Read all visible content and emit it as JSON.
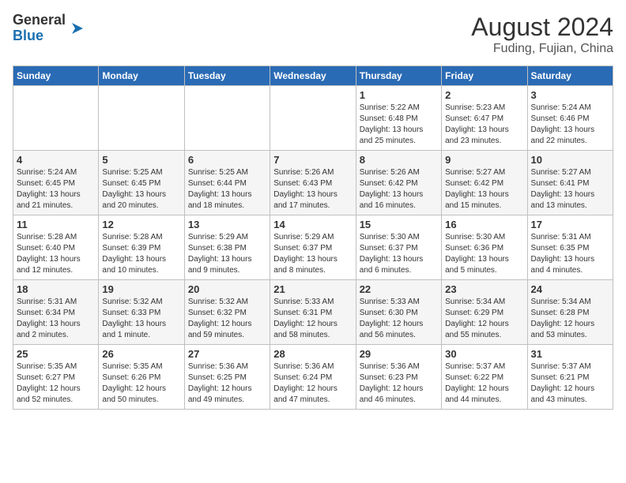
{
  "header": {
    "logo": {
      "general": "General",
      "blue": "Blue"
    },
    "title": "August 2024",
    "location": "Fuding, Fujian, China"
  },
  "calendar": {
    "days_of_week": [
      "Sunday",
      "Monday",
      "Tuesday",
      "Wednesday",
      "Thursday",
      "Friday",
      "Saturday"
    ],
    "weeks": [
      [
        {
          "day": "",
          "info": ""
        },
        {
          "day": "",
          "info": ""
        },
        {
          "day": "",
          "info": ""
        },
        {
          "day": "",
          "info": ""
        },
        {
          "day": "1",
          "info": "Sunrise: 5:22 AM\nSunset: 6:48 PM\nDaylight: 13 hours\nand 25 minutes."
        },
        {
          "day": "2",
          "info": "Sunrise: 5:23 AM\nSunset: 6:47 PM\nDaylight: 13 hours\nand 23 minutes."
        },
        {
          "day": "3",
          "info": "Sunrise: 5:24 AM\nSunset: 6:46 PM\nDaylight: 13 hours\nand 22 minutes."
        }
      ],
      [
        {
          "day": "4",
          "info": "Sunrise: 5:24 AM\nSunset: 6:45 PM\nDaylight: 13 hours\nand 21 minutes."
        },
        {
          "day": "5",
          "info": "Sunrise: 5:25 AM\nSunset: 6:45 PM\nDaylight: 13 hours\nand 20 minutes."
        },
        {
          "day": "6",
          "info": "Sunrise: 5:25 AM\nSunset: 6:44 PM\nDaylight: 13 hours\nand 18 minutes."
        },
        {
          "day": "7",
          "info": "Sunrise: 5:26 AM\nSunset: 6:43 PM\nDaylight: 13 hours\nand 17 minutes."
        },
        {
          "day": "8",
          "info": "Sunrise: 5:26 AM\nSunset: 6:42 PM\nDaylight: 13 hours\nand 16 minutes."
        },
        {
          "day": "9",
          "info": "Sunrise: 5:27 AM\nSunset: 6:42 PM\nDaylight: 13 hours\nand 15 minutes."
        },
        {
          "day": "10",
          "info": "Sunrise: 5:27 AM\nSunset: 6:41 PM\nDaylight: 13 hours\nand 13 minutes."
        }
      ],
      [
        {
          "day": "11",
          "info": "Sunrise: 5:28 AM\nSunset: 6:40 PM\nDaylight: 13 hours\nand 12 minutes."
        },
        {
          "day": "12",
          "info": "Sunrise: 5:28 AM\nSunset: 6:39 PM\nDaylight: 13 hours\nand 10 minutes."
        },
        {
          "day": "13",
          "info": "Sunrise: 5:29 AM\nSunset: 6:38 PM\nDaylight: 13 hours\nand 9 minutes."
        },
        {
          "day": "14",
          "info": "Sunrise: 5:29 AM\nSunset: 6:37 PM\nDaylight: 13 hours\nand 8 minutes."
        },
        {
          "day": "15",
          "info": "Sunrise: 5:30 AM\nSunset: 6:37 PM\nDaylight: 13 hours\nand 6 minutes."
        },
        {
          "day": "16",
          "info": "Sunrise: 5:30 AM\nSunset: 6:36 PM\nDaylight: 13 hours\nand 5 minutes."
        },
        {
          "day": "17",
          "info": "Sunrise: 5:31 AM\nSunset: 6:35 PM\nDaylight: 13 hours\nand 4 minutes."
        }
      ],
      [
        {
          "day": "18",
          "info": "Sunrise: 5:31 AM\nSunset: 6:34 PM\nDaylight: 13 hours\nand 2 minutes."
        },
        {
          "day": "19",
          "info": "Sunrise: 5:32 AM\nSunset: 6:33 PM\nDaylight: 13 hours\nand 1 minute."
        },
        {
          "day": "20",
          "info": "Sunrise: 5:32 AM\nSunset: 6:32 PM\nDaylight: 12 hours\nand 59 minutes."
        },
        {
          "day": "21",
          "info": "Sunrise: 5:33 AM\nSunset: 6:31 PM\nDaylight: 12 hours\nand 58 minutes."
        },
        {
          "day": "22",
          "info": "Sunrise: 5:33 AM\nSunset: 6:30 PM\nDaylight: 12 hours\nand 56 minutes."
        },
        {
          "day": "23",
          "info": "Sunrise: 5:34 AM\nSunset: 6:29 PM\nDaylight: 12 hours\nand 55 minutes."
        },
        {
          "day": "24",
          "info": "Sunrise: 5:34 AM\nSunset: 6:28 PM\nDaylight: 12 hours\nand 53 minutes."
        }
      ],
      [
        {
          "day": "25",
          "info": "Sunrise: 5:35 AM\nSunset: 6:27 PM\nDaylight: 12 hours\nand 52 minutes."
        },
        {
          "day": "26",
          "info": "Sunrise: 5:35 AM\nSunset: 6:26 PM\nDaylight: 12 hours\nand 50 minutes."
        },
        {
          "day": "27",
          "info": "Sunrise: 5:36 AM\nSunset: 6:25 PM\nDaylight: 12 hours\nand 49 minutes."
        },
        {
          "day": "28",
          "info": "Sunrise: 5:36 AM\nSunset: 6:24 PM\nDaylight: 12 hours\nand 47 minutes."
        },
        {
          "day": "29",
          "info": "Sunrise: 5:36 AM\nSunset: 6:23 PM\nDaylight: 12 hours\nand 46 minutes."
        },
        {
          "day": "30",
          "info": "Sunrise: 5:37 AM\nSunset: 6:22 PM\nDaylight: 12 hours\nand 44 minutes."
        },
        {
          "day": "31",
          "info": "Sunrise: 5:37 AM\nSunset: 6:21 PM\nDaylight: 12 hours\nand 43 minutes."
        }
      ]
    ]
  }
}
